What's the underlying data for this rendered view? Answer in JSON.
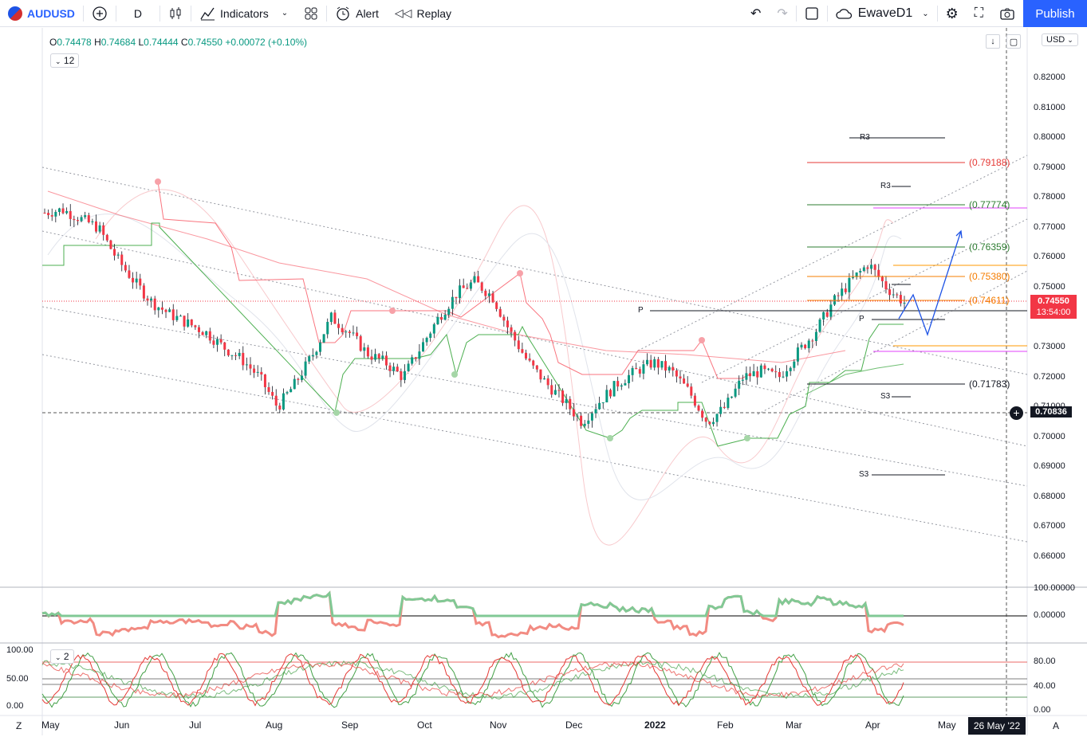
{
  "toolbar": {
    "symbol": "AUDUSD",
    "interval": "D",
    "indicators_label": "Indicators",
    "alert_label": "Alert",
    "replay_label": "Replay",
    "layout_name": "EwaveD1",
    "publish_label": "Publish"
  },
  "legend": {
    "o_label": "O",
    "o": "0.74478",
    "h_label": "H",
    "h": "0.74684",
    "l_label": "L",
    "l": "0.74444",
    "c_label": "C",
    "c": "0.74550",
    "change": "+0.00072 (+0.10%)",
    "indicator_count": "12",
    "pane3_count": "2"
  },
  "currency": "USD",
  "price_axis": [
    "0.82000",
    "0.81000",
    "0.80000",
    "0.79000",
    "0.78000",
    "0.77000",
    "0.76000",
    "0.75000",
    "0.74000",
    "0.73000",
    "0.72000",
    "0.71000",
    "0.70000",
    "0.69000",
    "0.68000",
    "0.67000",
    "0.66000"
  ],
  "current_price": {
    "value": "0.74550",
    "countdown": "13:54:00"
  },
  "crosshair_price": "0.70836",
  "pane2_axis": [
    "100.00000",
    "0.00000"
  ],
  "pane3_left_axis": [
    "100.00",
    "50.00",
    "0.00"
  ],
  "pane3_right_axis": [
    "80.00",
    "40.00",
    "0.00"
  ],
  "time_axis": [
    "May",
    "Jun",
    "Jul",
    "Aug",
    "Sep",
    "Oct",
    "Nov",
    "Dec",
    "2022",
    "Feb",
    "Mar",
    "Apr",
    "May"
  ],
  "crosshair_date": "26 May '22",
  "axis_buttons": {
    "left": "Z",
    "right": "A"
  },
  "fib_levels": [
    {
      "label": "(0.79188)",
      "color": "#e53935"
    },
    {
      "label": "(0.77774)",
      "color": "#2e7d32"
    },
    {
      "label": "(0.76359)",
      "color": "#2e7d32"
    },
    {
      "label": "(0.75380)",
      "color": "#f57c00"
    },
    {
      "label": "(0.74611)",
      "color": "#f57c00"
    },
    {
      "label": "(0.71783)",
      "color": "#131722"
    }
  ],
  "pivot_labels": [
    "R3",
    "R3",
    "P",
    "P",
    "S3",
    "S3"
  ],
  "colors": {
    "up": "#089981",
    "down": "#f23645",
    "accent": "#2962ff",
    "price_tag": "#f23645"
  },
  "chart_data": {
    "type": "candlestick",
    "y_range": [
      0.655,
      0.835
    ],
    "x_months": [
      "May",
      "Jun",
      "Jul",
      "Aug",
      "Sep",
      "Oct",
      "Nov",
      "Dec",
      "2022",
      "Feb",
      "Mar",
      "Apr",
      "May"
    ],
    "approx_closes": [
      0.775,
      0.776,
      0.773,
      0.77,
      0.76,
      0.752,
      0.745,
      0.741,
      0.738,
      0.735,
      0.73,
      0.726,
      0.72,
      0.71,
      0.718,
      0.728,
      0.74,
      0.735,
      0.728,
      0.725,
      0.72,
      0.73,
      0.74,
      0.748,
      0.752,
      0.747,
      0.735,
      0.725,
      0.718,
      0.712,
      0.705,
      0.712,
      0.718,
      0.722,
      0.725,
      0.722,
      0.715,
      0.705,
      0.71,
      0.72,
      0.722,
      0.72,
      0.728,
      0.735,
      0.745,
      0.752,
      0.758,
      0.75,
      0.745
    ]
  }
}
